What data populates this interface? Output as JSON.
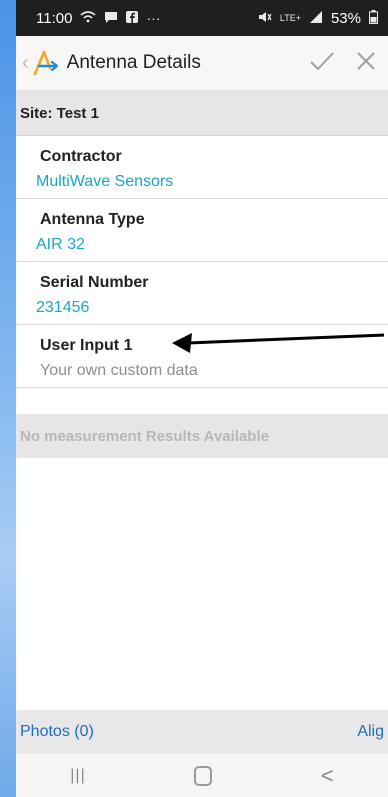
{
  "status": {
    "time": "11:00",
    "dots": "···",
    "signal_label": "LTE+",
    "battery": "53%"
  },
  "toolbar": {
    "title": "Antenna Details",
    "confirm_icon": "check-icon",
    "close_icon": "close-icon"
  },
  "site": {
    "label": "Site: Test 1"
  },
  "fields": [
    {
      "label": "Contractor",
      "value": "MultiWave Sensors"
    },
    {
      "label": "Antenna Type",
      "value": "AIR 32"
    },
    {
      "label": "Serial Number",
      "value": "231456"
    }
  ],
  "user_input": {
    "label": "User Input 1",
    "value": "Your own custom data"
  },
  "measurements": {
    "message": "No measurement Results Available"
  },
  "bottom": {
    "photos": "Photos (0)",
    "align": "Alig"
  },
  "nav": {
    "recents": "|||",
    "back": "<"
  },
  "colors": {
    "accent": "#1aa6c8",
    "link": "#1e6fb8",
    "logo": "#f5a623"
  }
}
